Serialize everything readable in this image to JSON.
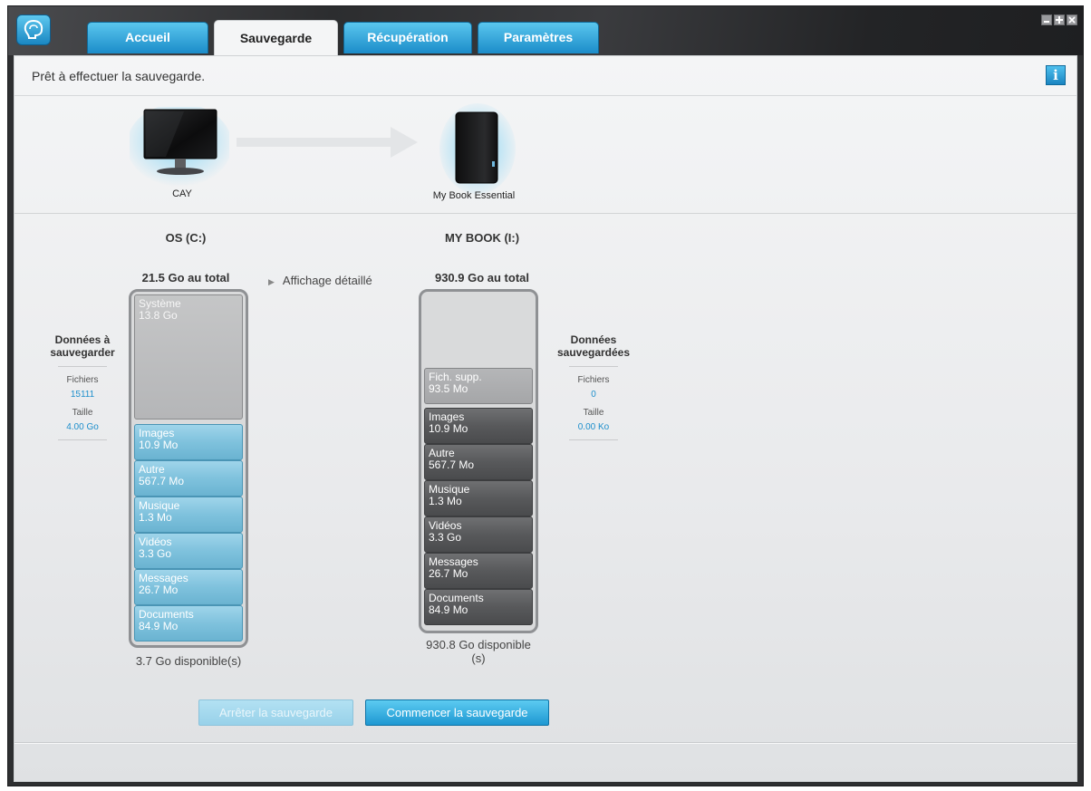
{
  "tabs": [
    {
      "label": "Accueil"
    },
    {
      "label": "Sauvegarde"
    },
    {
      "label": "Récupération"
    },
    {
      "label": "Paramètres"
    }
  ],
  "status": {
    "text": "Prêt à effectuer la sauvegarde."
  },
  "devices": {
    "source_label": "CAY",
    "target_label": "My Book Essential"
  },
  "source_drive": {
    "name": "OS (C:)",
    "total": "21.5 Go au total",
    "system": {
      "label": "Système",
      "size": "13.8 Go"
    },
    "categories": [
      {
        "label": "Images",
        "size": "10.9 Mo"
      },
      {
        "label": "Autre",
        "size": "567.7 Mo"
      },
      {
        "label": "Musique",
        "size": "1.3 Mo"
      },
      {
        "label": "Vidéos",
        "size": "3.3 Go"
      },
      {
        "label": "Messages",
        "size": "26.7 Mo"
      },
      {
        "label": "Documents",
        "size": "84.9 Mo"
      }
    ],
    "available": "3.7 Go disponible(s)"
  },
  "target_drive": {
    "name": "MY BOOK (I:)",
    "total": "930.9 Go au total",
    "supp": {
      "label": "Fich. supp.",
      "size": "93.5 Mo"
    },
    "categories": [
      {
        "label": "Images",
        "size": "10.9 Mo"
      },
      {
        "label": "Autre",
        "size": "567.7 Mo"
      },
      {
        "label": "Musique",
        "size": "1.3 Mo"
      },
      {
        "label": "Vidéos",
        "size": "3.3 Go"
      },
      {
        "label": "Messages",
        "size": "26.7 Mo"
      },
      {
        "label": "Documents",
        "size": "84.9 Mo"
      }
    ],
    "available": "930.8 Go disponible (s)"
  },
  "detail_toggle": {
    "label": "Affichage détaillé"
  },
  "to_backup": {
    "title": "Données à sauvegarder",
    "files_label": "Fichiers",
    "files_value": "15111",
    "size_label": "Taille",
    "size_value": "4.00 Go"
  },
  "backed_up": {
    "title": "Données sauvegardées",
    "files_label": "Fichiers",
    "files_value": "0",
    "size_label": "Taille",
    "size_value": "0.00 Ko"
  },
  "buttons": {
    "stop": "Arrêter la sauvegarde",
    "start": "Commencer la sauvegarde"
  },
  "colors": {
    "accent": "#1e98d2",
    "link": "#1e8fcc"
  }
}
